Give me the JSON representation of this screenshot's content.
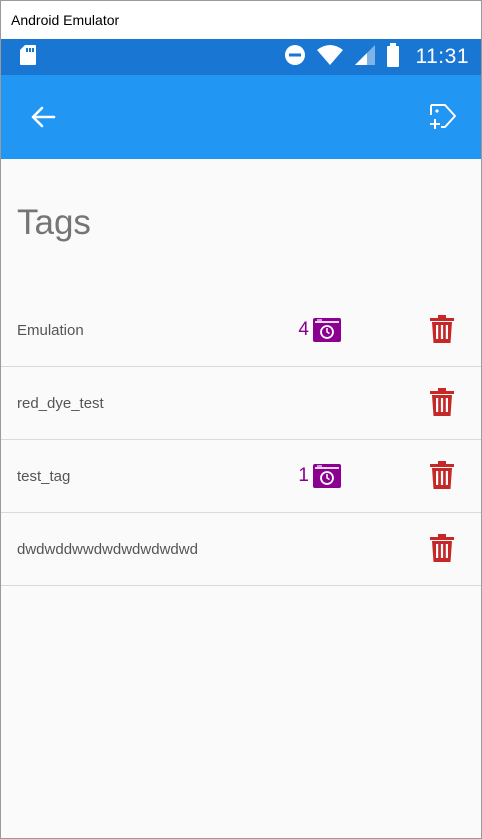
{
  "window": {
    "title": "Android Emulator"
  },
  "status_bar": {
    "time": "11:31",
    "icons": [
      "sd-card-icon",
      "do-not-disturb-icon",
      "wifi-icon",
      "signal-icon",
      "battery-icon"
    ]
  },
  "app_bar": {
    "back_icon": "arrow-back-icon",
    "action_icon": "add-tag-icon"
  },
  "page": {
    "title": "Tags"
  },
  "tags": [
    {
      "name": "Emulation",
      "count": "4"
    },
    {
      "name": "red_dye_test",
      "count": ""
    },
    {
      "name": "test_tag",
      "count": "1"
    },
    {
      "name": "dwdwddwwdwdwdwdwdwd",
      "count": ""
    }
  ],
  "colors": {
    "status_bar": "#1976d2",
    "app_bar": "#2196f3",
    "count_accent": "#8b0090",
    "delete": "#c62828",
    "title_text": "#757575"
  }
}
